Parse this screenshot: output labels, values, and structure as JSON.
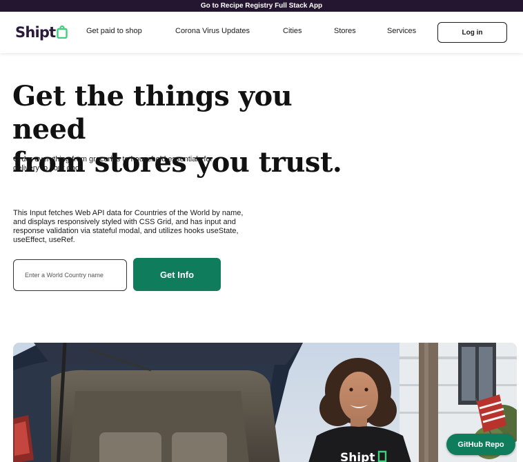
{
  "topbar": {
    "link_text": "Go to Recipe Registry Full Stack App"
  },
  "header": {
    "logo_text": "Shipt",
    "nav": [
      {
        "label": "Get paid to shop"
      },
      {
        "label": "Corona Virus Updates"
      },
      {
        "label": "Cities"
      },
      {
        "label": "Stores"
      },
      {
        "label": "Services"
      }
    ],
    "login_label": "Log in"
  },
  "hero": {
    "title_line1": "Get the things you need",
    "title_line2": "from stores you trust.",
    "subtitle": "Order everything from groceries to household essentials for delivery to your door.",
    "description": "This Input fetches Web API data for Countries of the World by name, and displays responsively styled with CSS Grid, and has input and response validation via stateful modal, and utilizes hooks useState, useEffect, useRef."
  },
  "search": {
    "placeholder": "Enter a World Country name",
    "value": "",
    "button_label": "Get Info"
  },
  "image": {
    "shirt_text": "Shipt"
  },
  "github": {
    "label": "GitHub Repo"
  },
  "colors": {
    "topbar_bg": "#241630",
    "brand_purple": "#2b1a3d",
    "brand_green": "#0f7c5c",
    "logo_bag_green": "#3dd17b"
  },
  "icons": [
    "shopping-bag-icon"
  ]
}
